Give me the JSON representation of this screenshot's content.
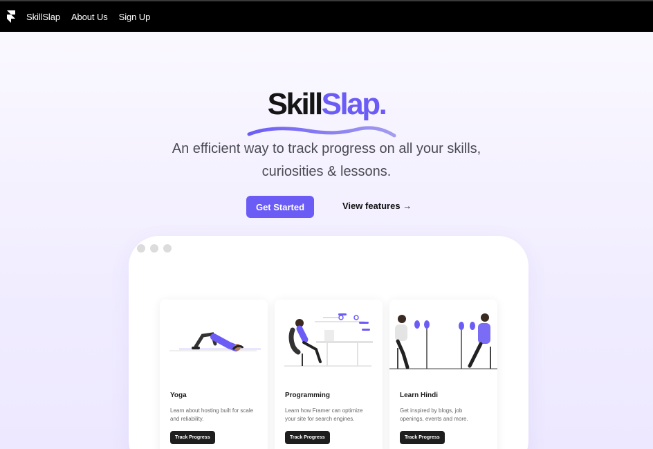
{
  "nav": {
    "logo_icon": "framer-logo-icon",
    "items": [
      {
        "label": "SkillSlap"
      },
      {
        "label": "About Us"
      },
      {
        "label": "Sign Up"
      }
    ]
  },
  "hero": {
    "brand_part1": "Skill",
    "brand_part2": "Slap.",
    "tagline_line1": "An efficient way to track progress on all your skills,",
    "tagline_line2": "curiosities & lessons.",
    "primary_button": "Get Started",
    "secondary_link": "View features →"
  },
  "cards": [
    {
      "title": "Yoga",
      "description": "Learn about hosting built for scale and reliability.",
      "button": "Track Progress",
      "illustration": "yoga-illustration"
    },
    {
      "title": "Programming",
      "description": "Learn how Framer can optimize your site for search engines.",
      "button": "Track Progress",
      "illustration": "programming-illustration"
    },
    {
      "title": "Learn Hindi",
      "description": "Get inspired by blogs, job openings, events and more.",
      "button": "Track Progress",
      "illustration": "podcast-illustration"
    }
  ],
  "colors": {
    "accent": "#6b5cf6",
    "background": "#f3f0ff",
    "navbar": "#000000",
    "card_button": "#1e1e1e"
  }
}
